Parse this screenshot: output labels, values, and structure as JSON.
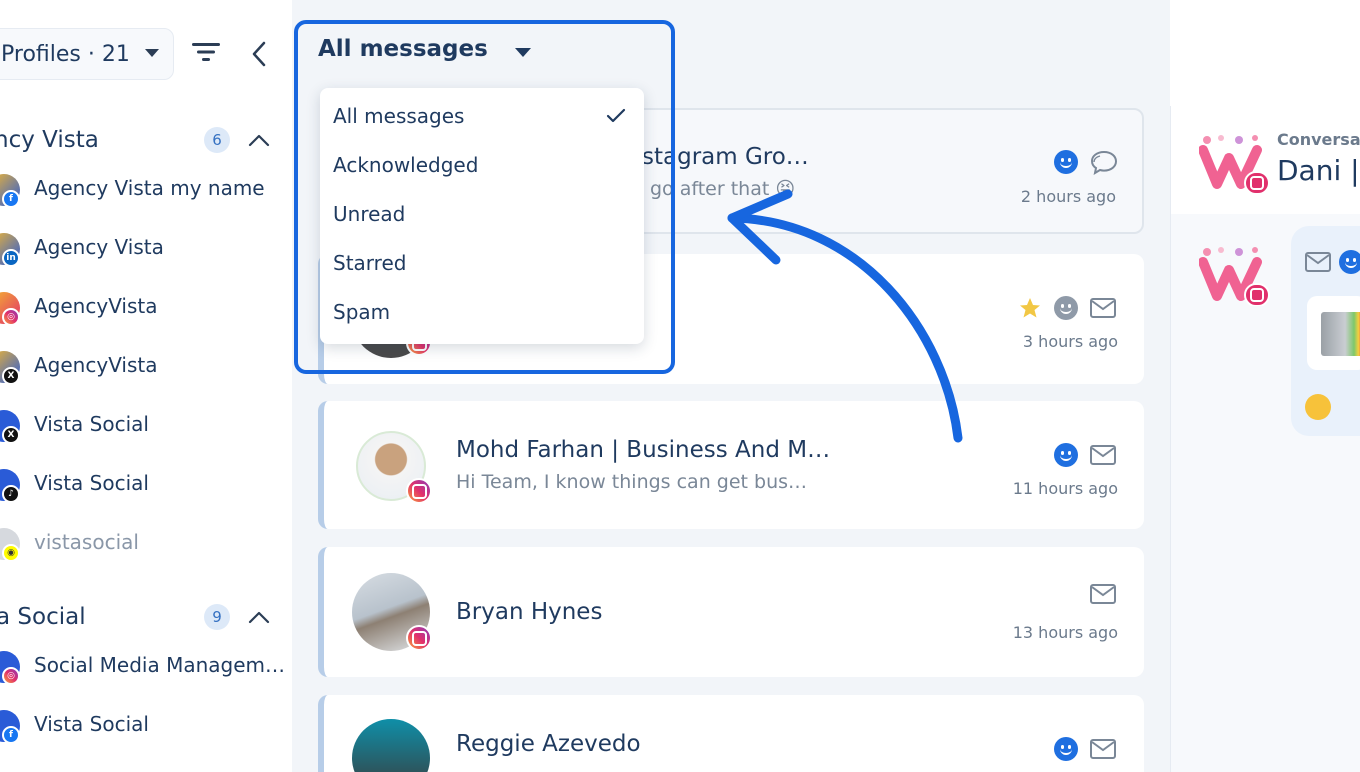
{
  "sidebar": {
    "profiles_label": "Profiles · 21",
    "groups": [
      {
        "name": "ncy Vista",
        "count": "6",
        "items": [
          {
            "label": "Agency Vista my name",
            "network": "facebook"
          },
          {
            "label": "Agency Vista",
            "network": "linkedin"
          },
          {
            "label": "AgencyVista",
            "network": "instagram"
          },
          {
            "label": "AgencyVista",
            "network": "x"
          },
          {
            "label": "Vista Social",
            "network": "x"
          },
          {
            "label": "Vista Social",
            "network": "tiktok"
          },
          {
            "label": "vistasocial",
            "network": "snapchat"
          }
        ]
      },
      {
        "name": "a Social",
        "count": "9",
        "items": [
          {
            "label": "Social Media Managem…",
            "network": "instagram"
          },
          {
            "label": "Vista Social",
            "network": "facebook"
          }
        ]
      }
    ]
  },
  "filter": {
    "selected": "All messages",
    "options": [
      "All messages",
      "Acknowledged",
      "Unread",
      "Starred",
      "Spam"
    ]
  },
  "messages": [
    {
      "name": "stagram Gro…",
      "preview": "go after that 😝",
      "time": "2 hours ago"
    },
    {
      "name": "",
      "preview": "",
      "time": "3 hours ago"
    },
    {
      "name": "Mohd Farhan | Business And M…",
      "preview": "Hi Team, I know things can get bus…",
      "time": "11 hours ago"
    },
    {
      "name": "Bryan Hynes",
      "preview": "",
      "time": "13 hours ago"
    },
    {
      "name": "Reggie Azevedo",
      "preview": "",
      "time": ""
    }
  ],
  "conversation": {
    "label": "Conversat",
    "name": "Dani | C"
  },
  "colors": {
    "accent": "#1766df",
    "text": "#1f3a5f",
    "muted": "#7a8797",
    "card_border": "#b7cde8",
    "star": "#f2c744"
  },
  "icons": [
    "filter-icon",
    "chevron-left-icon",
    "chevron-up-icon",
    "check-icon",
    "smile-icon",
    "mail-icon",
    "chat-icon",
    "star-icon",
    "instagram-icon"
  ]
}
